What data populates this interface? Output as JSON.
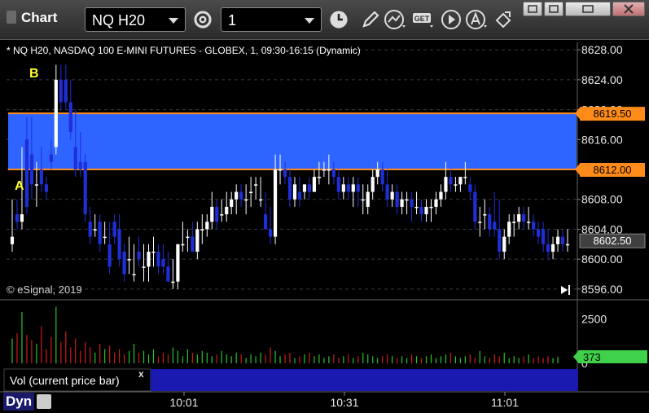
{
  "window": {
    "title": "Chart"
  },
  "toolbar": {
    "symbol": "NQ H20",
    "interval": "1",
    "icons": [
      "gear-icon",
      "clock-icon",
      "pencil-icon",
      "study-icon",
      "get-icon",
      "play-icon",
      "alert-icon",
      "move-icon"
    ]
  },
  "chart": {
    "header": "* NQ H20, NASDAQ 100 E-MINI FUTURES - GLOBEX, 1, 09:30-16:15 (Dynamic)",
    "copyright": "© eSignal, 2019",
    "labels": {
      "a": "A",
      "b": "B"
    },
    "price_ticks": [
      "8628.00",
      "8624.00",
      "8620.00",
      "8616.00",
      "8612.00",
      "8608.00",
      "8604.00",
      "8600.00",
      "8596.00"
    ],
    "price_tick_values": [
      8628,
      8624,
      8620,
      8616,
      8612,
      8608,
      8604,
      8600,
      8596
    ],
    "zone": {
      "upper": "8619.50",
      "lower": "8612.00",
      "upper_value": 8619.5,
      "lower_value": 8612.0,
      "color": "#2e64ff",
      "line_color": "#ff8c1a"
    },
    "last_price": "8602.50",
    "last_price_value": 8602.5,
    "time_ticks": [
      "10:01",
      "10:31",
      "11:01"
    ],
    "colors": {
      "up": "#ffffff",
      "down": "#1e2fd8",
      "grid": "#3a3a3a",
      "axis_text": "#e8e8e8"
    }
  },
  "volume": {
    "study_label": "Vol (current price bar)",
    "close_label": "x",
    "ticks": [
      "2500",
      "0"
    ],
    "tick_values": [
      2500,
      0
    ],
    "current": "373",
    "current_value": 373,
    "colors": {
      "up": "#27c427",
      "down": "#d01a1a",
      "badge": "#3fd14a"
    }
  },
  "status": {
    "mode": "Dyn"
  },
  "chart_data": {
    "type": "candlestick",
    "title": "* NQ H20, NASDAQ 100 E-MINI FUTURES - GLOBEX, 1, 09:30-16:15 (Dynamic)",
    "ylim": [
      8595,
      8629
    ],
    "bars": [
      [
        8602,
        8608,
        8603,
        8601
      ],
      [
        8606,
        8608,
        8605,
        8604
      ],
      [
        8605,
        8615,
        8606,
        8604
      ],
      [
        8616,
        8619,
        8607,
        8606
      ],
      [
        8614,
        8619,
        8610,
        8608
      ],
      [
        8610,
        8613,
        8610,
        8607
      ],
      [
        8612,
        8615,
        8610,
        8609
      ],
      [
        8610,
        8611,
        8609,
        8608
      ],
      [
        8614,
        8616,
        8613,
        8612
      ],
      [
        8615,
        8626,
        8624,
        8614
      ],
      [
        8624,
        8626,
        8621,
        8620
      ],
      [
        8624,
        8626,
        8621,
        8620
      ],
      [
        8621,
        8624,
        8617,
        8616
      ],
      [
        8615,
        8620,
        8612,
        8611
      ],
      [
        8613,
        8617,
        8612,
        8611
      ],
      [
        8613,
        8614,
        8606,
        8605
      ],
      [
        8605,
        8607,
        8603,
        8602
      ],
      [
        8604,
        8606,
        8604,
        8603
      ],
      [
        8605,
        8606,
        8602,
        8601
      ],
      [
        8603,
        8605,
        8603,
        8602
      ],
      [
        8602,
        8605,
        8599,
        8598
      ],
      [
        8605,
        8606,
        8603,
        8602
      ],
      [
        8604,
        8606,
        8600,
        8599
      ],
      [
        8601,
        8602,
        8598,
        8597
      ],
      [
        8600,
        8603,
        8600,
        8598
      ],
      [
        8598,
        8602,
        8598,
        8597
      ],
      [
        8601,
        8603,
        8600,
        8599
      ],
      [
        8599,
        8602,
        8599,
        8597
      ],
      [
        8599,
        8602,
        8601,
        8597
      ],
      [
        8601,
        8603,
        8601,
        8599
      ],
      [
        8601,
        8602,
        8599,
        8598
      ],
      [
        8600,
        8602,
        8599,
        8598
      ],
      [
        8599,
        8601,
        8597,
        8597
      ],
      [
        8597,
        8600,
        8597,
        8596
      ],
      [
        8597,
        8602,
        8602,
        8596
      ],
      [
        8602,
        8605,
        8602,
        8601
      ],
      [
        8603,
        8604,
        8603,
        8601
      ],
      [
        8603,
        8605,
        8601,
        8601
      ],
      [
        8601,
        8605,
        8604,
        8600
      ],
      [
        8604,
        8606,
        8604,
        8602
      ],
      [
        8604,
        8606,
        8605,
        8603
      ],
      [
        8605,
        8609,
        8607,
        8604
      ],
      [
        8607,
        8608,
        8605,
        8604
      ],
      [
        8606,
        8608,
        8606,
        8605
      ],
      [
        8606,
        8609,
        8607,
        8605
      ],
      [
        8607,
        8609,
        8608,
        8606
      ],
      [
        8608,
        8610,
        8609,
        8606
      ],
      [
        8609,
        8610,
        8608,
        8607
      ],
      [
        8608,
        8610,
        8608,
        8606
      ],
      [
        8609,
        8611,
        8609,
        8607
      ],
      [
        8610,
        8611,
        8610,
        8608
      ],
      [
        8608,
        8611,
        8608,
        8607
      ],
      [
        8606,
        8609,
        8604,
        8604
      ],
      [
        8604,
        8607,
        8603,
        8602
      ],
      [
        8603,
        8614,
        8612,
        8602
      ],
      [
        8612,
        8614,
        8612,
        8610
      ],
      [
        8612,
        8613,
        8611,
        8610
      ],
      [
        8611,
        8612,
        8608,
        8607
      ],
      [
        8608,
        8611,
        8610,
        8607
      ],
      [
        8609,
        8611,
        8608,
        8607
      ],
      [
        8609,
        8610,
        8610,
        8608
      ],
      [
        8610,
        8611,
        8609,
        8608
      ],
      [
        8609,
        8612,
        8611,
        8609
      ],
      [
        8611,
        8613,
        8611,
        8610
      ],
      [
        8612,
        8613,
        8612,
        8611
      ],
      [
        8612,
        8614,
        8612,
        8610
      ],
      [
        8612,
        8613,
        8611,
        8610
      ],
      [
        8611,
        8612,
        8609,
        8608
      ],
      [
        8609,
        8611,
        8610,
        8608
      ],
      [
        8610,
        8611,
        8609,
        8608
      ],
      [
        8609,
        8611,
        8610,
        8607
      ],
      [
        8610,
        8611,
        8609,
        8607
      ],
      [
        8608,
        8610,
        8608,
        8606
      ],
      [
        8607,
        8610,
        8609,
        8606
      ],
      [
        8609,
        8612,
        8611,
        8608
      ],
      [
        8611,
        8613,
        8612,
        8610
      ],
      [
        8612,
        8613,
        8610,
        8609
      ],
      [
        8610,
        8612,
        8608,
        8607
      ],
      [
        8608,
        8610,
        8609,
        8607
      ],
      [
        8609,
        8610,
        8607,
        8606
      ],
      [
        8607,
        8609,
        8608,
        8606
      ],
      [
        8608,
        8609,
        8608,
        8606
      ],
      [
        8608,
        8609,
        8607,
        8605
      ],
      [
        8607,
        8609,
        8607,
        8606
      ],
      [
        8607,
        8608,
        8606,
        8605
      ],
      [
        8606,
        8608,
        8607,
        8605
      ],
      [
        8607,
        8608,
        8607,
        8605
      ],
      [
        8607,
        8609,
        8608,
        8606
      ],
      [
        8608,
        8610,
        8609,
        8607
      ],
      [
        8609,
        8613,
        8611,
        8608
      ],
      [
        8611,
        8612,
        8610,
        8609
      ],
      [
        8610,
        8611,
        8610,
        8609
      ],
      [
        8610,
        8611,
        8611,
        8609
      ],
      [
        8611,
        8613,
        8611,
        8610
      ],
      [
        8610,
        8611,
        8609,
        8608
      ],
      [
        8609,
        8610,
        8605,
        8604
      ],
      [
        8605,
        8607,
        8605,
        8603
      ],
      [
        8606,
        8608,
        8606,
        8604
      ],
      [
        8606,
        8607,
        8604,
        8603
      ],
      [
        8605,
        8609,
        8604,
        8603
      ],
      [
        8604,
        8608,
        8601,
        8600
      ],
      [
        8601,
        8604,
        8603,
        8600
      ],
      [
        8603,
        8606,
        8605,
        8602
      ],
      [
        8605,
        8606,
        8605,
        8603
      ],
      [
        8605,
        8607,
        8606,
        8604
      ],
      [
        8606,
        8607,
        8605,
        8604
      ],
      [
        8605,
        8607,
        8605,
        8604
      ],
      [
        8605,
        8606,
        8604,
        8603
      ],
      [
        8604,
        8605,
        8603,
        8602
      ],
      [
        8604,
        8605,
        8602,
        8601
      ],
      [
        8602,
        8604,
        8601,
        8600
      ],
      [
        8601,
        8603,
        8602,
        8600
      ],
      [
        8602,
        8604,
        8603,
        8601
      ],
      [
        8603,
        8604,
        8602,
        8601
      ],
      [
        8602,
        8604,
        8602,
        8601
      ]
    ],
    "volume": [
      1400,
      1700,
      2900,
      1600,
      1300,
      1100,
      2100,
      800,
      1500,
      3200,
      1200,
      1800,
      900,
      1400,
      700,
      1200,
      900,
      600,
      1100,
      800,
      1000,
      600,
      800,
      500,
      700,
      1100,
      600,
      700,
      500,
      800,
      400,
      600,
      500,
      900,
      700,
      400,
      800,
      600,
      500,
      700,
      600,
      400,
      500,
      700,
      500,
      400,
      600,
      500,
      300,
      500,
      400,
      600,
      500,
      900,
      700,
      400,
      500,
      600,
      300,
      400,
      500,
      600,
      400,
      500,
      300,
      400,
      500,
      300,
      400,
      500,
      300,
      400,
      600,
      500,
      400,
      300,
      400,
      500,
      400,
      300,
      400,
      300,
      500,
      400,
      300,
      400,
      500,
      300,
      400,
      500,
      600,
      400,
      300,
      400,
      500,
      300,
      700,
      400,
      300,
      500,
      400,
      600,
      300,
      400,
      300,
      400,
      500,
      300,
      400,
      300,
      400,
      300,
      373
    ]
  }
}
